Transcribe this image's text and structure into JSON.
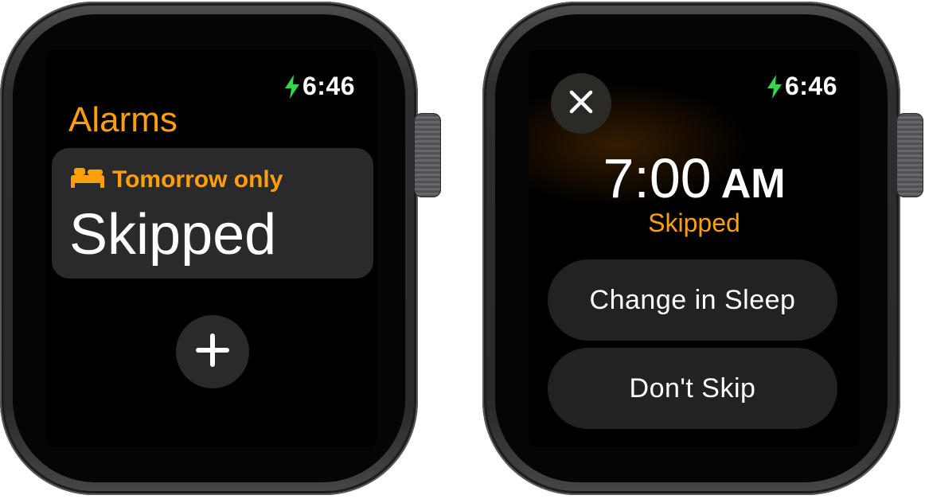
{
  "colors": {
    "accent": "#ff9f0a",
    "charging": "#32d74b"
  },
  "left_watch": {
    "status": {
      "time": "6:46",
      "icon": "charging-bolt-icon"
    },
    "title": "Alarms",
    "alarm_card": {
      "icon": "bed-icon",
      "label": "Tomorrow only",
      "status": "Skipped"
    },
    "add_button": {
      "icon": "plus-icon"
    }
  },
  "right_watch": {
    "status": {
      "time": "6:46",
      "icon": "charging-bolt-icon"
    },
    "close_button": {
      "icon": "close-icon"
    },
    "alarm_time": "7:00",
    "alarm_period": "AM",
    "alarm_state": "Skipped",
    "actions": [
      {
        "label": "Change in Sleep"
      },
      {
        "label": "Don't Skip"
      }
    ]
  }
}
